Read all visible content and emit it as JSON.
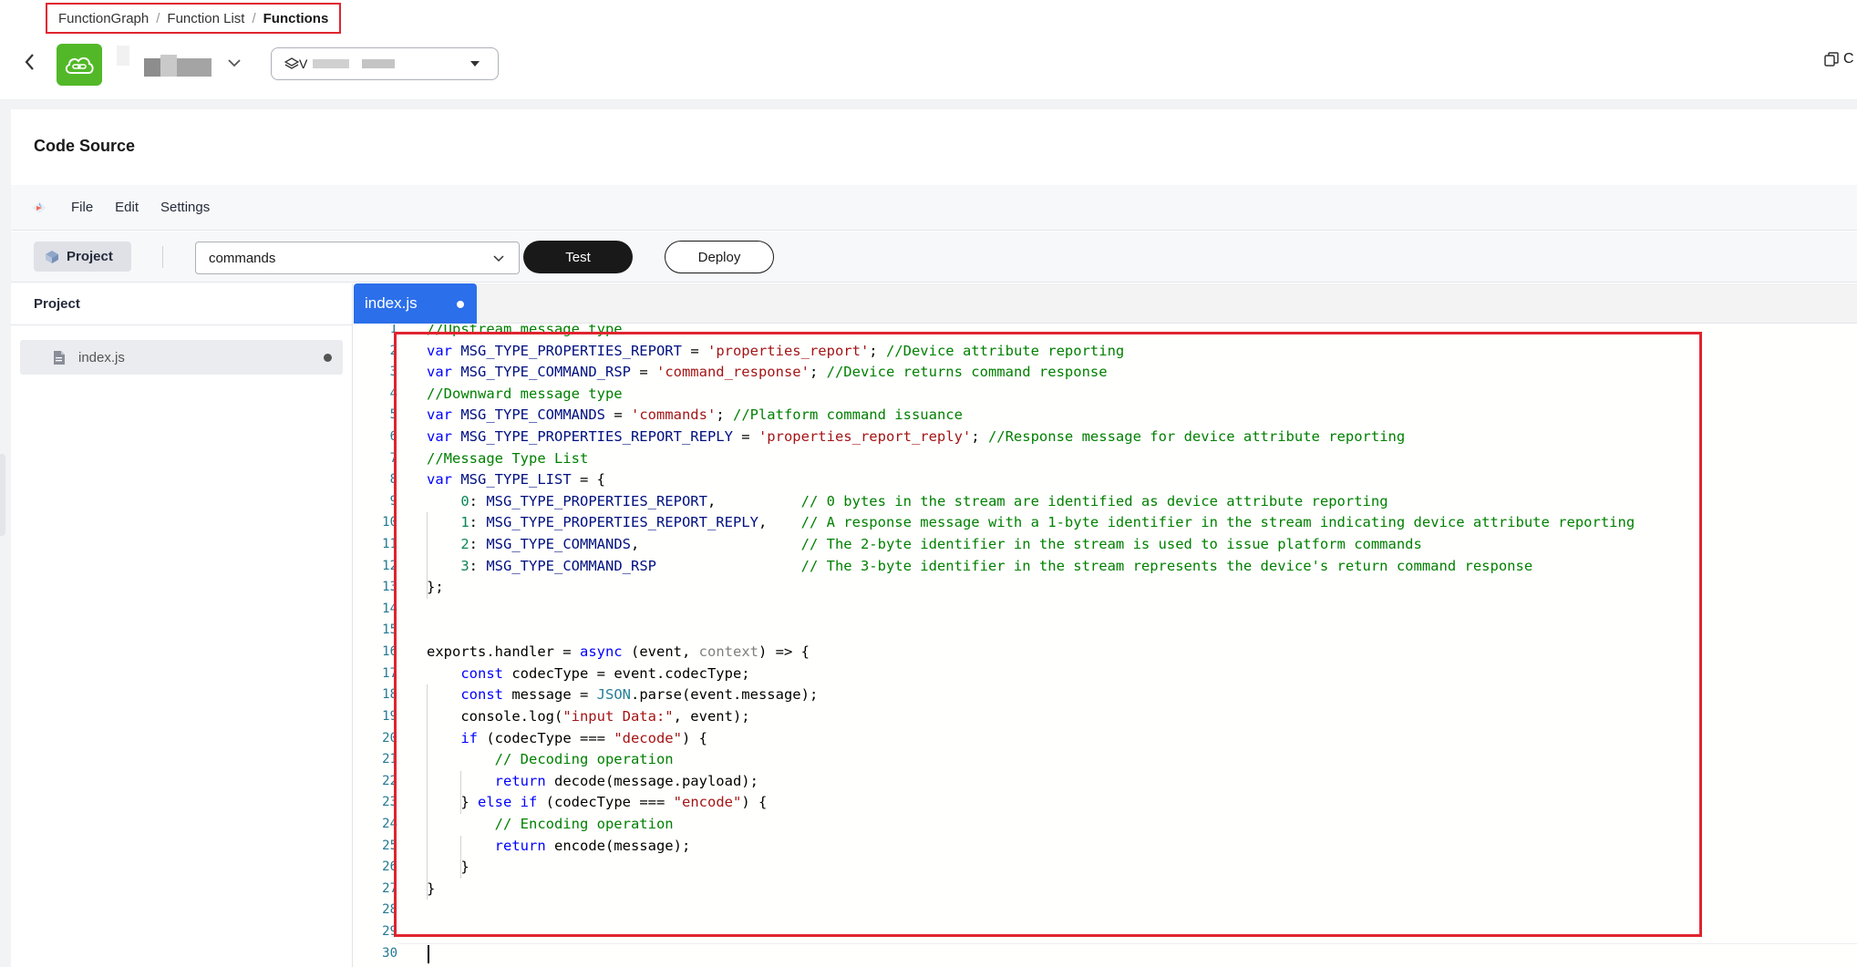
{
  "breadcrumb": {
    "items": [
      "FunctionGraph",
      "Function List",
      "Functions"
    ],
    "separator": "/"
  },
  "header": {
    "version_prefix": "V",
    "copy_action_label": "C"
  },
  "section": {
    "title": "Code Source"
  },
  "menubar": {
    "items": [
      "File",
      "Edit",
      "Settings"
    ]
  },
  "toolbar": {
    "project_label": "Project",
    "event_selected": "commands",
    "test_label": "Test",
    "deploy_label": "Deploy"
  },
  "sidebar": {
    "title": "Project",
    "files": [
      {
        "name": "index.js",
        "modified": true
      }
    ]
  },
  "editor": {
    "tabs": [
      {
        "label": "index.js",
        "active": true,
        "modified": true
      }
    ],
    "language": "javascript",
    "line_numbers": [
      1,
      2,
      3,
      4,
      5,
      6,
      7,
      8,
      9,
      10,
      11,
      12,
      13,
      14,
      15,
      16,
      17,
      18,
      19,
      20,
      21,
      22,
      23,
      24,
      25,
      26,
      27,
      28,
      29,
      30
    ],
    "code_lines": [
      "//Upstream message type",
      "var MSG_TYPE_PROPERTIES_REPORT = 'properties_report'; //Device attribute reporting",
      "var MSG_TYPE_COMMAND_RSP = 'command_response'; //Device returns command response",
      "//Downward message type",
      "var MSG_TYPE_COMMANDS = 'commands'; //Platform command issuance",
      "var MSG_TYPE_PROPERTIES_REPORT_REPLY = 'properties_report_reply'; //Response message for device attribute reporting",
      "//Message Type List",
      "var MSG_TYPE_LIST = {",
      "    0: MSG_TYPE_PROPERTIES_REPORT,          // 0 bytes in the stream are identified as device attribute reporting",
      "    1: MSG_TYPE_PROPERTIES_REPORT_REPLY,    // A response message with a 1-byte identifier in the stream indicating device attribute reporting",
      "    2: MSG_TYPE_COMMANDS,                   // The 2-byte identifier in the stream is used to issue platform commands",
      "    3: MSG_TYPE_COMMAND_RSP                 // The 3-byte identifier in the stream represents the device's return command response",
      "};",
      "",
      "",
      "exports.handler = async (event, context) => {",
      "    const codecType = event.codecType;",
      "    const message = JSON.parse(event.message);",
      "    console.log(\"input Data:\", event);",
      "    if (codecType === \"decode\") {",
      "        // Decoding operation",
      "        return decode(message.payload);",
      "    } else if (codecType === \"encode\") {",
      "        // Encoding operation",
      "        return encode(message);",
      "    }",
      "}",
      "",
      ""
    ]
  },
  "colors": {
    "accent": "#2b6fea",
    "highlight_border": "#e0242f",
    "test_button": "#191919",
    "logo_green": "#52b828",
    "comment": "#008000",
    "keyword": "#0000ff",
    "string": "#a31515"
  },
  "icons": {
    "back": "chevron-left-icon",
    "function_logo": "link-cloud-icon",
    "function_dropdown": "chevron-down-icon",
    "version": "layers-icon",
    "copy": "copy-icon",
    "project": "cube-icon",
    "file": "file-icon"
  }
}
